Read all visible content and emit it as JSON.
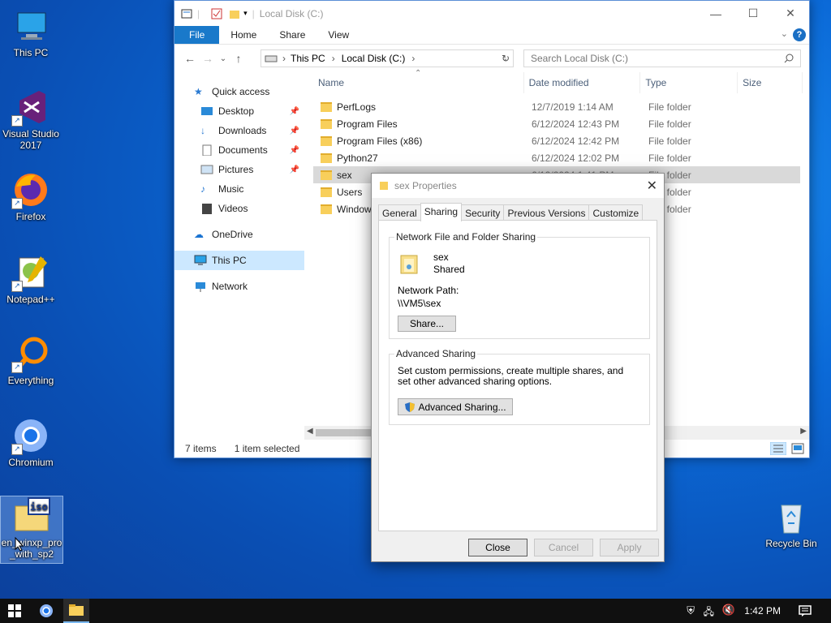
{
  "desktop": {
    "icons": [
      {
        "label": "This PC"
      },
      {
        "label": "Visual Studio 2017"
      },
      {
        "label": "Firefox"
      },
      {
        "label": "Notepad++"
      },
      {
        "label": "Everything"
      },
      {
        "label": "Chromium"
      },
      {
        "label": "en_winxp_pro_with_sp2"
      },
      {
        "label": "Recycle Bin"
      }
    ]
  },
  "explorer": {
    "title": "Local Disk (C:)",
    "ribbon_tabs": [
      "File",
      "Home",
      "Share",
      "View"
    ],
    "help": "?",
    "breadcrumb": [
      "This PC",
      "Local Disk (C:)"
    ],
    "search_placeholder": "Search Local Disk (C:)",
    "nav": {
      "quick_access": "Quick access",
      "items": [
        "Desktop",
        "Downloads",
        "Documents",
        "Pictures",
        "Music",
        "Videos"
      ],
      "onedrive": "OneDrive",
      "this_pc": "This PC",
      "network": "Network"
    },
    "columns": [
      "Name",
      "Date modified",
      "Type",
      "Size"
    ],
    "files": [
      {
        "name": "PerfLogs",
        "date": "12/7/2019 1:14 AM",
        "type": "File folder"
      },
      {
        "name": "Program Files",
        "date": "6/12/2024 12:43 PM",
        "type": "File folder"
      },
      {
        "name": "Program Files (x86)",
        "date": "6/12/2024 12:42 PM",
        "type": "File folder"
      },
      {
        "name": "Python27",
        "date": "6/12/2024 12:02 PM",
        "type": "File folder"
      },
      {
        "name": "sex",
        "date": "6/12/2024 1:41 PM",
        "type": "File folder"
      },
      {
        "name": "Users",
        "date": "",
        "type": "File folder"
      },
      {
        "name": "Windows",
        "date": "",
        "type": "File folder"
      }
    ],
    "status": {
      "items": "7 items",
      "selected": "1 item selected"
    }
  },
  "dialog": {
    "title": "sex Properties",
    "tabs": [
      "General",
      "Sharing",
      "Security",
      "Previous Versions",
      "Customize"
    ],
    "network_group": "Network File and Folder Sharing",
    "folder_name": "sex",
    "share_state": "Shared",
    "network_path_label": "Network Path:",
    "network_path": "\\\\VM5\\sex",
    "share_button": "Share...",
    "advanced_group": "Advanced Sharing",
    "advanced_desc": "Set custom permissions, create multiple shares, and set other advanced sharing options.",
    "advanced_button": "Advanced Sharing...",
    "close": "Close",
    "cancel": "Cancel",
    "apply": "Apply"
  },
  "taskbar": {
    "time": "1:42 PM"
  },
  "colors": {
    "accent": "#1979ca",
    "folder": "#f8cf5b",
    "selection": "#cce8ff"
  }
}
